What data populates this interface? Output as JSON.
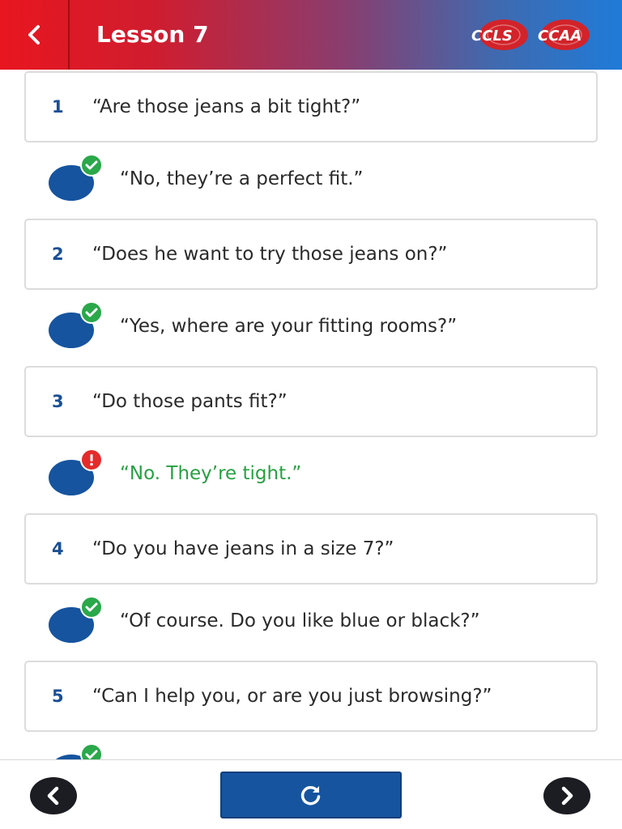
{
  "header": {
    "title": "Lesson 7",
    "back_icon": "chevron-left-icon",
    "logo_text_left": "CCLS",
    "logo_text_right": "CCAA"
  },
  "colors": {
    "primary_blue": "#16549f",
    "correct_green": "#2aa84a",
    "error_red": "#e42b2b",
    "nav_dark": "#1b1d22"
  },
  "items": [
    {
      "number": "1",
      "question": "“Are those jeans a bit tight?”",
      "answer": "“No, they’re a perfect fit.”",
      "status": "correct"
    },
    {
      "number": "2",
      "question": "“Does he want to try those jeans on?”",
      "answer": "“Yes, where are your fitting rooms?”",
      "status": "correct"
    },
    {
      "number": "3",
      "question": "“Do those pants fit?”",
      "answer": "“No. They’re tight.”",
      "status": "incorrect"
    },
    {
      "number": "4",
      "question": "“Do you have jeans in a size 7?”",
      "answer": "“Of course. Do you like blue or black?”",
      "status": "correct"
    },
    {
      "number": "5",
      "question": "“Can I help you, or are you just browsing?”",
      "answer": "",
      "status": "correct"
    }
  ],
  "footer": {
    "prev_icon": "chevron-left-icon",
    "reload_icon": "reload-icon",
    "next_icon": "chevron-right-icon"
  }
}
